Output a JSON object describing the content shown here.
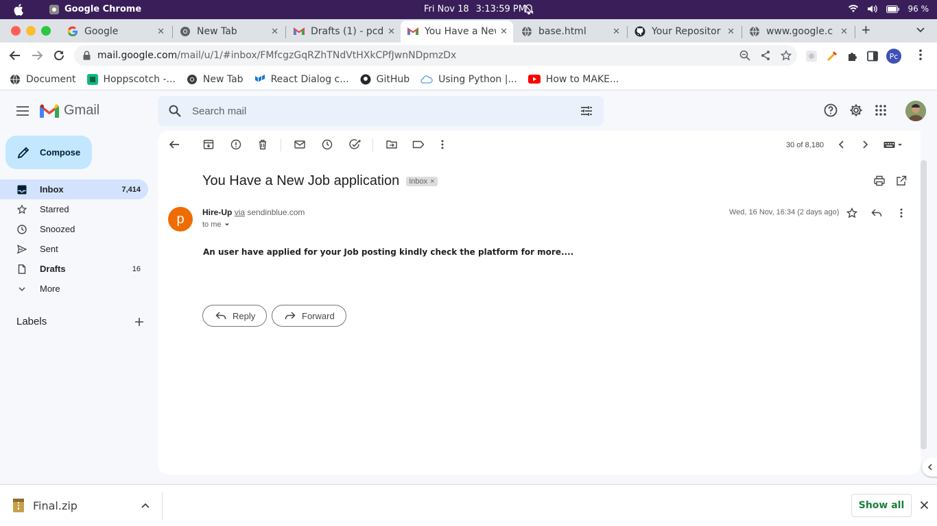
{
  "system": {
    "app_name": "Google Chrome",
    "date": "Fri Nov 18",
    "time": "3:13:59 PM",
    "battery": "96 %"
  },
  "tabs": [
    {
      "title": "Google",
      "icon": "google-icon"
    },
    {
      "title": "New Tab",
      "icon": "chrome-icon"
    },
    {
      "title": "Drafts (1) - pcd",
      "icon": "gmail-icon"
    },
    {
      "title": "You Have a New",
      "icon": "gmail-icon",
      "active": true
    },
    {
      "title": "base.html",
      "icon": "globe-icon"
    },
    {
      "title": "Your Repositor",
      "icon": "github-icon"
    },
    {
      "title": "www.google.c",
      "icon": "globe-icon"
    }
  ],
  "address": {
    "host": "mail.google.com",
    "path": "/mail/u/1/#inbox/FMfcgzGqRZhTNdVtHXkCPfJwnNDpmzDx"
  },
  "profile_initials": "Pc",
  "bookmarks": [
    {
      "title": "Document",
      "icon": "globe-icon"
    },
    {
      "title": "Hoppscotch -...",
      "icon": "hoppscotch-icon"
    },
    {
      "title": "New Tab",
      "icon": "chrome-icon"
    },
    {
      "title": "React Dialog c...",
      "icon": "mui-icon"
    },
    {
      "title": "GitHub",
      "icon": "github-icon"
    },
    {
      "title": "Using Python |...",
      "icon": "cloud-icon"
    },
    {
      "title": "How to MAKE...",
      "icon": "youtube-icon"
    }
  ],
  "gmail": {
    "logo_text": "Gmail",
    "search_placeholder": "Search mail",
    "compose_label": "Compose",
    "nav": [
      {
        "label": "Inbox",
        "count": "7,414",
        "icon": "inbox-icon"
      },
      {
        "label": "Starred",
        "count": "",
        "icon": "star-icon"
      },
      {
        "label": "Snoozed",
        "count": "",
        "icon": "clock-icon"
      },
      {
        "label": "Sent",
        "count": "",
        "icon": "send-icon"
      },
      {
        "label": "Drafts",
        "count": "16",
        "icon": "draft-icon"
      },
      {
        "label": "More",
        "count": "",
        "icon": "chevron-down-icon"
      }
    ],
    "labels_title": "Labels"
  },
  "message": {
    "pager": "30 of 8,180",
    "subject": "You Have a New Job application",
    "label_chip": "Inbox",
    "sender_initial": "p",
    "sender_name": "Hire-Up",
    "via_text": "via",
    "via_domain": "sendinblue.com",
    "recipient": "to me",
    "date": "Wed, 16 Nov, 16:34 (2 days ago)",
    "body": "An user have applied for your Job posting kindly check the platform for more....",
    "reply_label": "Reply",
    "forward_label": "Forward"
  },
  "download": {
    "filename": "Final.zip",
    "show_all": "Show all"
  },
  "colors": {
    "sysbar": "#3a1e5a",
    "accent_blue": "#c2e7ff",
    "inbox_active": "#d3e3fd",
    "sender_avatar": "#ef6c00",
    "show_all": "#188038"
  }
}
